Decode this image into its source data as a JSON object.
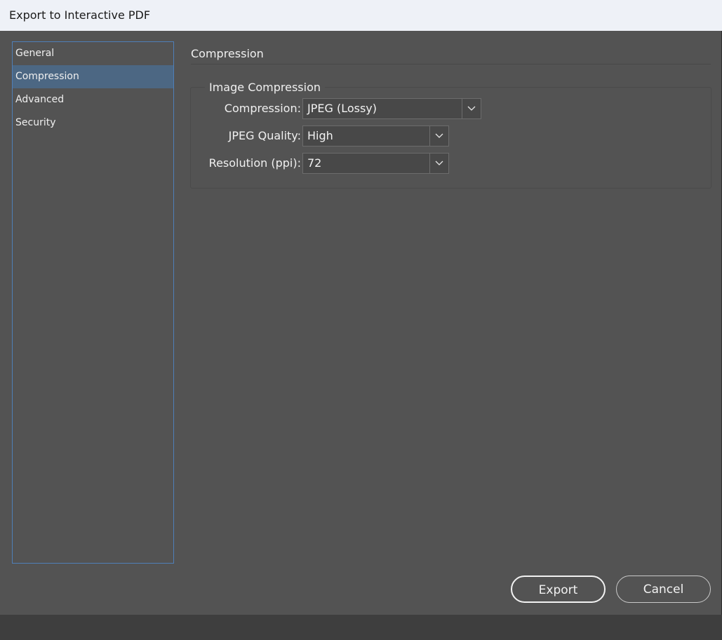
{
  "window": {
    "title": "Export to Interactive PDF"
  },
  "sidebar": {
    "items": [
      {
        "label": "General"
      },
      {
        "label": "Compression"
      },
      {
        "label": "Advanced"
      },
      {
        "label": "Security"
      }
    ],
    "selected": "Compression"
  },
  "main": {
    "section_title": "Compression",
    "group_title": "Image Compression",
    "fields": {
      "compression": {
        "label": "Compression:",
        "value": "JPEG (Lossy)"
      },
      "jpeg_quality": {
        "label": "JPEG Quality:",
        "value": "High"
      },
      "resolution": {
        "label": "Resolution (ppi):",
        "value": "72"
      }
    }
  },
  "buttons": {
    "export": "Export",
    "cancel": "Cancel"
  },
  "colors": {
    "dialog_bg": "#535353",
    "titlebar_bg": "#eef1f7",
    "selection_bg": "#4c6783",
    "sidebar_border": "#4f7fb8"
  }
}
